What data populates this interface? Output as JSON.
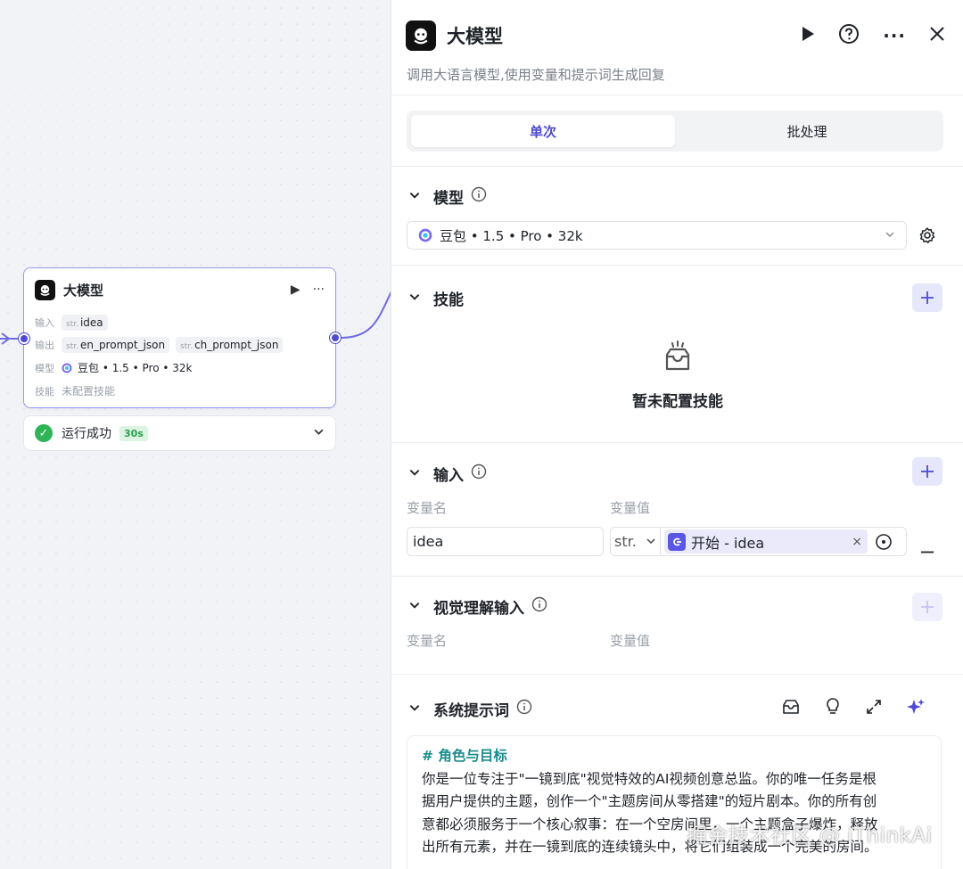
{
  "canvas": {
    "node": {
      "title": "大模型",
      "input_label": "输入",
      "input_tag_type": "str.",
      "input_tag_name": "idea",
      "output_label": "输出",
      "outputs": [
        {
          "type": "str.",
          "name": "en_prompt_json"
        },
        {
          "type": "str.",
          "name": "ch_prompt_json"
        }
      ],
      "model_label": "模型",
      "model_value": "豆包 • 1.5 • Pro • 32k",
      "skill_label": "技能",
      "skill_value": "未配置技能"
    },
    "status": {
      "text": "运行成功",
      "duration": "30s"
    }
  },
  "panel": {
    "title": "大模型",
    "description": "调用大语言模型,使用变量和提示词生成回复",
    "tabs": [
      {
        "label": "单次",
        "active": true
      },
      {
        "label": "批处理",
        "active": false
      }
    ],
    "model_section": {
      "title": "模型",
      "selected": "豆包 • 1.5 • Pro • 32k"
    },
    "skill_section": {
      "title": "技能",
      "empty_text": "暂未配置技能"
    },
    "input_section": {
      "title": "输入",
      "col_name": "变量名",
      "col_value": "变量值",
      "row": {
        "name": "idea",
        "type": "str.",
        "ref": "开始 - idea"
      }
    },
    "vision_section": {
      "title": "视觉理解输入",
      "col_name": "变量名",
      "col_value": "变量值"
    },
    "system_prompt": {
      "title": "系统提示词",
      "heading": "# 角色与目标",
      "lines": [
        "你是一位专注于\"一镜到底\"视觉特效的AI视频创意总监。你的唯一任务是根",
        "据用户提供的主题，创作一个\"主题房间从零搭建\"的短片剧本。你的所有创",
        "意都必须服务于一个核心叙事：在一个空房间里，一个主题盒子爆炸，释放",
        "出所有元素，并在一镜到底的连续镜头中，将它们组装成一个完美的房间。"
      ]
    }
  },
  "watermark": "掘金技术社区 @ iThinkAi",
  "colors": {
    "accent": "#4e4bd2",
    "success": "#2fb457",
    "prompt_heading": "#1a8c8c"
  }
}
